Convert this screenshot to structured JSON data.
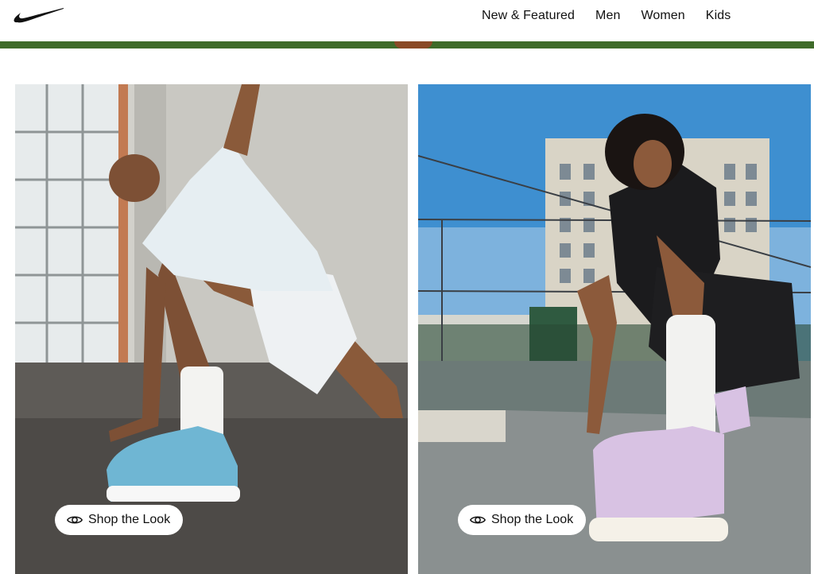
{
  "header": {
    "logo_icon": "nike-swoosh-icon",
    "nav": [
      {
        "label": "New & Featured"
      },
      {
        "label": "Men"
      },
      {
        "label": "Women"
      },
      {
        "label": "Kids"
      }
    ]
  },
  "tiles": [
    {
      "shop_label": "Shop the Look",
      "icon": "eye-icon"
    },
    {
      "shop_label": "Shop the Look",
      "icon": "eye-icon"
    }
  ],
  "colors": {
    "banner_green": "#3f6b2a",
    "text": "#111111",
    "shoe_blue": "#6fb6d3",
    "shoe_lilac": "#d8c2e3",
    "sky_blue": "#3e8fd0"
  }
}
